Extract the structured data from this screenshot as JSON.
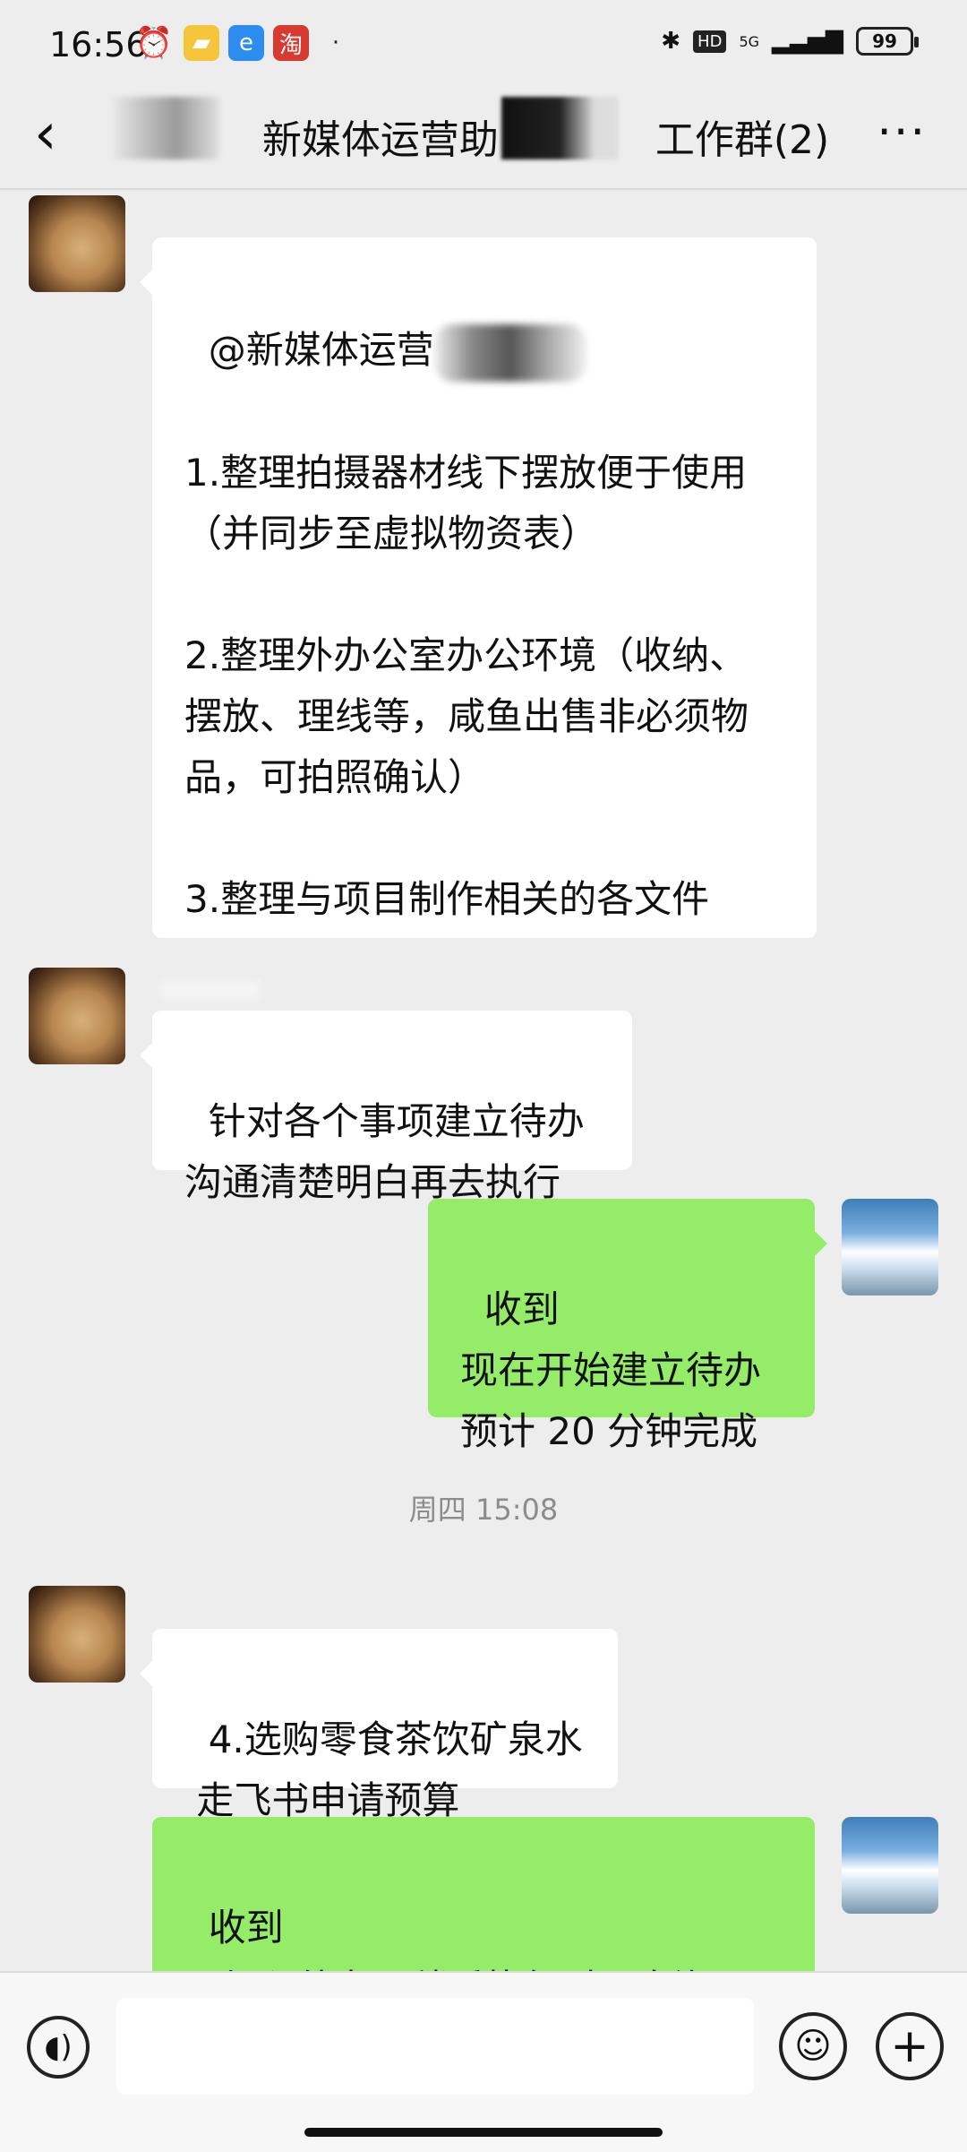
{
  "status_bar": {
    "time": "16:56",
    "network": "5G",
    "hd": "HD",
    "battery": "99",
    "icons": [
      "alarm-icon",
      "folder-icon",
      "browser-icon",
      "taobao-icon",
      "dot-icon",
      "bluetooth-icon",
      "signal-icon"
    ]
  },
  "header": {
    "title_part1": "新媒体运营助",
    "title_part2": "工作群(2)",
    "back_icon": "back-chevron-icon",
    "more_icon": "more-dots-icon"
  },
  "messages": [
    {
      "side": "left",
      "avatar": "lion-avatar",
      "mention": "@新媒体运营",
      "text": "\n\n1.整理拍摄器材线下摆放便于使用（并同步至虚拟物资表）\n\n2.整理外办公室办公环境（收纳、摆放、理线等，咸鱼出售非必须物品，可拍照确认）\n\n3.整理与项目制作相关的各文件"
    },
    {
      "side": "left",
      "avatar": "lion-avatar",
      "text": "针对各个事项建立待办\n沟通清楚明白再去执行"
    },
    {
      "side": "right",
      "avatar": "snow-mountain-avatar",
      "text": "收到\n现在开始建立待办\n预计 20 分钟完成"
    },
    {
      "side": "left",
      "avatar": "lion-avatar",
      "text": "4.选购零食茶饮矿泉水\n 走飞书申请预算"
    },
    {
      "side": "right",
      "avatar": "snow-mountain-avatar",
      "text": "收到\n已加入待办，稍后执行时再次沟通"
    }
  ],
  "timestamp": "周四 15:08",
  "input_bar": {
    "voice_icon": "voice-icon",
    "emoji_icon": "emoji-icon",
    "plus_icon": "plus-icon"
  },
  "colors": {
    "background": "#ededed",
    "incoming_bubble": "#ffffff",
    "outgoing_bubble": "#95ec69"
  }
}
